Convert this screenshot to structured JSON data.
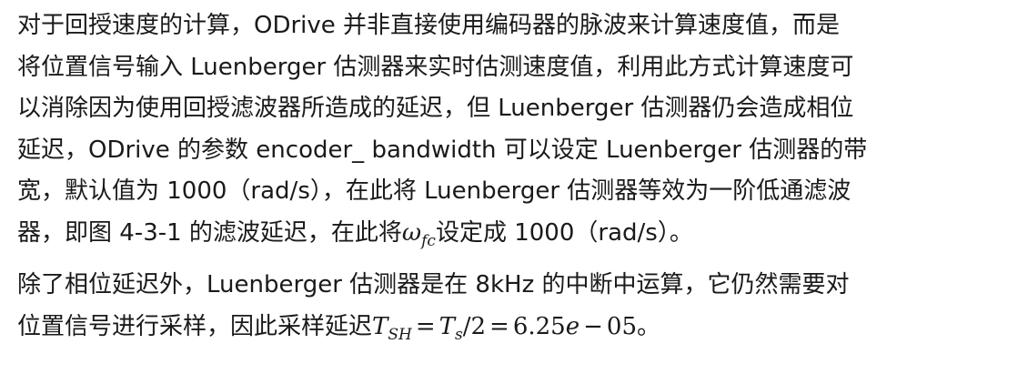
{
  "paragraphs": [
    {
      "lines": [
        "对于回授速度的计算，ODrive 并非直接使用编码器的脉波来计算速度值，而是",
        "将位置信号输入 Luenberger 估测器来实时估测速度值，利用此方式计算速度可",
        "以消除因为使用回授滤波器所造成的延迟，但 Luenberger 估测器仍会造成相位",
        "延迟，ODrive 的参数 encoder_ bandwidth 可以设定 Luenberger 估测器的带",
        "宽，默认值为 1000（rad/s），在此将 Luenberger 估测器等效为一阶低通滤波"
      ],
      "last_line": {
        "prefix": "器，即图 4-3-1 的滤波延迟，在此将",
        "omega": "ω",
        "omega_sub": "fc",
        "suffix": "设定成 1000（rad/s）。"
      }
    },
    {
      "lines": [
        "除了相位延迟外，Luenberger 估测器是在 8kHz 的中断中运算，它仍然需要对"
      ],
      "last_line": {
        "prefix": "位置信号进行采样，因此采样延迟",
        "T": "T",
        "T_sub": "SH",
        "eq1": "=",
        "Ts": "T",
        "Ts_sub": "s",
        "div": "/2",
        "eq2": "=",
        "value": "6.25",
        "e": "e",
        "minus": "−",
        "exp": "05",
        "suffix": "。"
      }
    }
  ]
}
